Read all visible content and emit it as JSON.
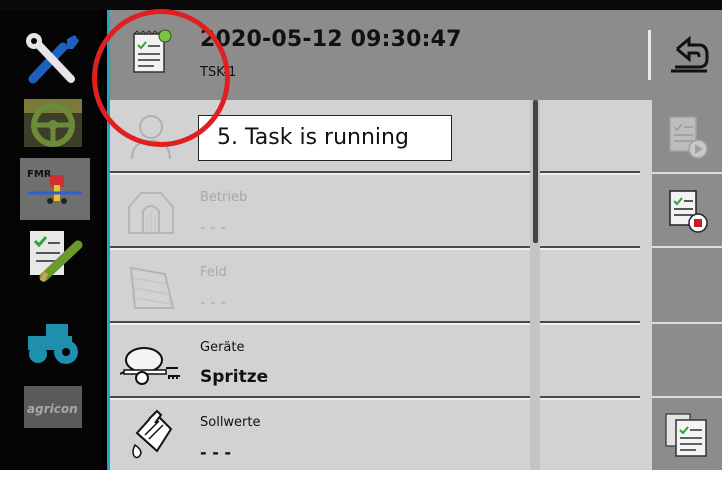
{
  "header": {
    "title": "2020-05-12 09:30:47",
    "subtitle": "TSK-1"
  },
  "annotation": {
    "text": "5. Task is running"
  },
  "rows": [
    {
      "label": "",
      "value": "",
      "icon": "person-icon"
    },
    {
      "label": "Betrieb",
      "value": "- - -",
      "icon": "barn-icon"
    },
    {
      "label": "Feld",
      "value": "- - -",
      "icon": "field-icon"
    },
    {
      "label": "Geräte",
      "value": "Spritze",
      "icon": "sprayer-icon"
    },
    {
      "label": "Sollwerte",
      "value": "- - -",
      "icon": "canister-icon"
    }
  ],
  "sidebar_apps": [
    {
      "name": "settings-icon"
    },
    {
      "name": "steering-icon"
    },
    {
      "name": "fmr-icon",
      "text": "FMR"
    },
    {
      "name": "tasks-icon"
    },
    {
      "name": "tractor-icon"
    },
    {
      "name": "agricon-icon",
      "text": "agricon"
    }
  ],
  "softkeys": [
    {
      "name": "start-task-icon"
    },
    {
      "name": "stop-task-icon"
    },
    {
      "name": "task-list-icon"
    }
  ],
  "colors": {
    "header_bg": "#8c8c8c",
    "list_bg": "#d2d2d2",
    "accent_green": "#7cc142",
    "accent_red": "#e02020",
    "cyan": "#1aa9c9"
  }
}
